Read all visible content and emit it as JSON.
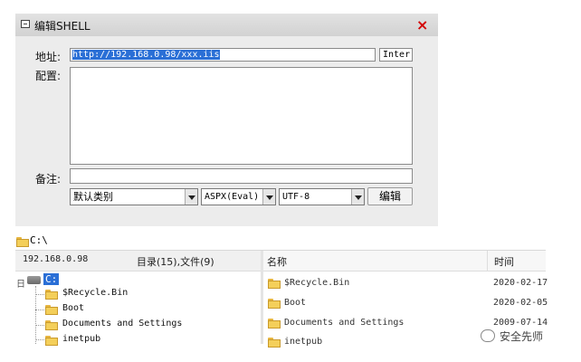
{
  "dialog": {
    "title": "编辑SHELL",
    "close": "×",
    "url_label": "地址:",
    "url_value": "http://192.168.0.98/xxx.iis",
    "type_value": "Inter",
    "config_label": "配置:",
    "note_label": "备注:",
    "category": "默认类别",
    "script_type": "ASPX(Eval)",
    "charset": "UTF-8",
    "edit_button": "编辑"
  },
  "file_manager": {
    "path": "C:\\",
    "host": "192.168.0.98",
    "counts": "目录(15),文件(9)",
    "col_name": "名称",
    "col_time": "时间",
    "tree_toggle": "日",
    "drive": "C:",
    "tree_items": [
      "$Recycle.Bin",
      "Boot",
      "Documents and Settings",
      "inetpub"
    ],
    "files": [
      {
        "name": "$Recycle.Bin",
        "time": "2020-02-17"
      },
      {
        "name": "Boot",
        "time": "2020-02-05"
      },
      {
        "name": "Documents and Settings",
        "time": "2009-07-14"
      },
      {
        "name": "inetpub",
        "time": ""
      }
    ]
  },
  "watermark": "安全先师"
}
